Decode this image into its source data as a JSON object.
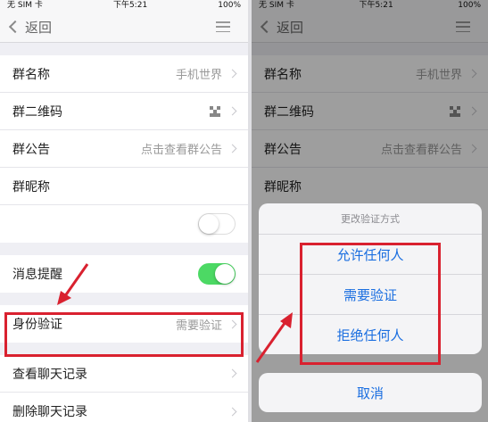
{
  "status": {
    "carrier": "无 SIM 卡",
    "time": "下午5:21",
    "battery": "100%"
  },
  "nav": {
    "back": "返回"
  },
  "rows": {
    "group_name": {
      "label": "群名称",
      "value": "手机世界"
    },
    "group_qr": {
      "label": "群二维码"
    },
    "group_notice": {
      "label": "群公告",
      "value": "点击查看群公告"
    },
    "group_nickname": {
      "label": "群昵称"
    },
    "message_alert": {
      "label": "消息提醒"
    },
    "identity_verify": {
      "label": "身份验证",
      "value": "需要验证"
    },
    "chat_history": {
      "label": "查看聊天记录"
    },
    "delete_history": {
      "label": "删除聊天记录"
    }
  },
  "sheet": {
    "title": "更改验证方式",
    "options": [
      "允许任何人",
      "需要验证",
      "拒绝任何人"
    ],
    "cancel": "取消"
  },
  "colors": {
    "toggle_on": "#4cd964",
    "highlight_box": "#d9212f",
    "sheet_text": "#1a6ee0"
  }
}
